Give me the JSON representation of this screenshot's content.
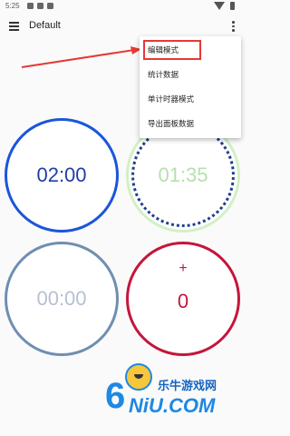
{
  "status_bar": {
    "time": "5:25"
  },
  "app_bar": {
    "title": "Default"
  },
  "timers": [
    {
      "value": "02:00",
      "color": "#1a56db"
    },
    {
      "value": "01:35",
      "color": "#d3f0c5",
      "ring_color": "#1f3f8f"
    },
    {
      "value": "00:00",
      "color": "#6f8fb0"
    },
    {
      "symbol": "+",
      "value": "0",
      "color": "#c4163c"
    }
  ],
  "menu": {
    "items": [
      {
        "label": "编辑模式",
        "highlighted": true
      },
      {
        "label": "统计数据"
      },
      {
        "label": "单计时器模式"
      },
      {
        "label": "导出面板数据"
      }
    ]
  },
  "watermark": {
    "digit": "6",
    "brand": "乐牛游戏网",
    "logo": "NiU.COM"
  },
  "colors": {
    "annotation": "#e53935"
  }
}
